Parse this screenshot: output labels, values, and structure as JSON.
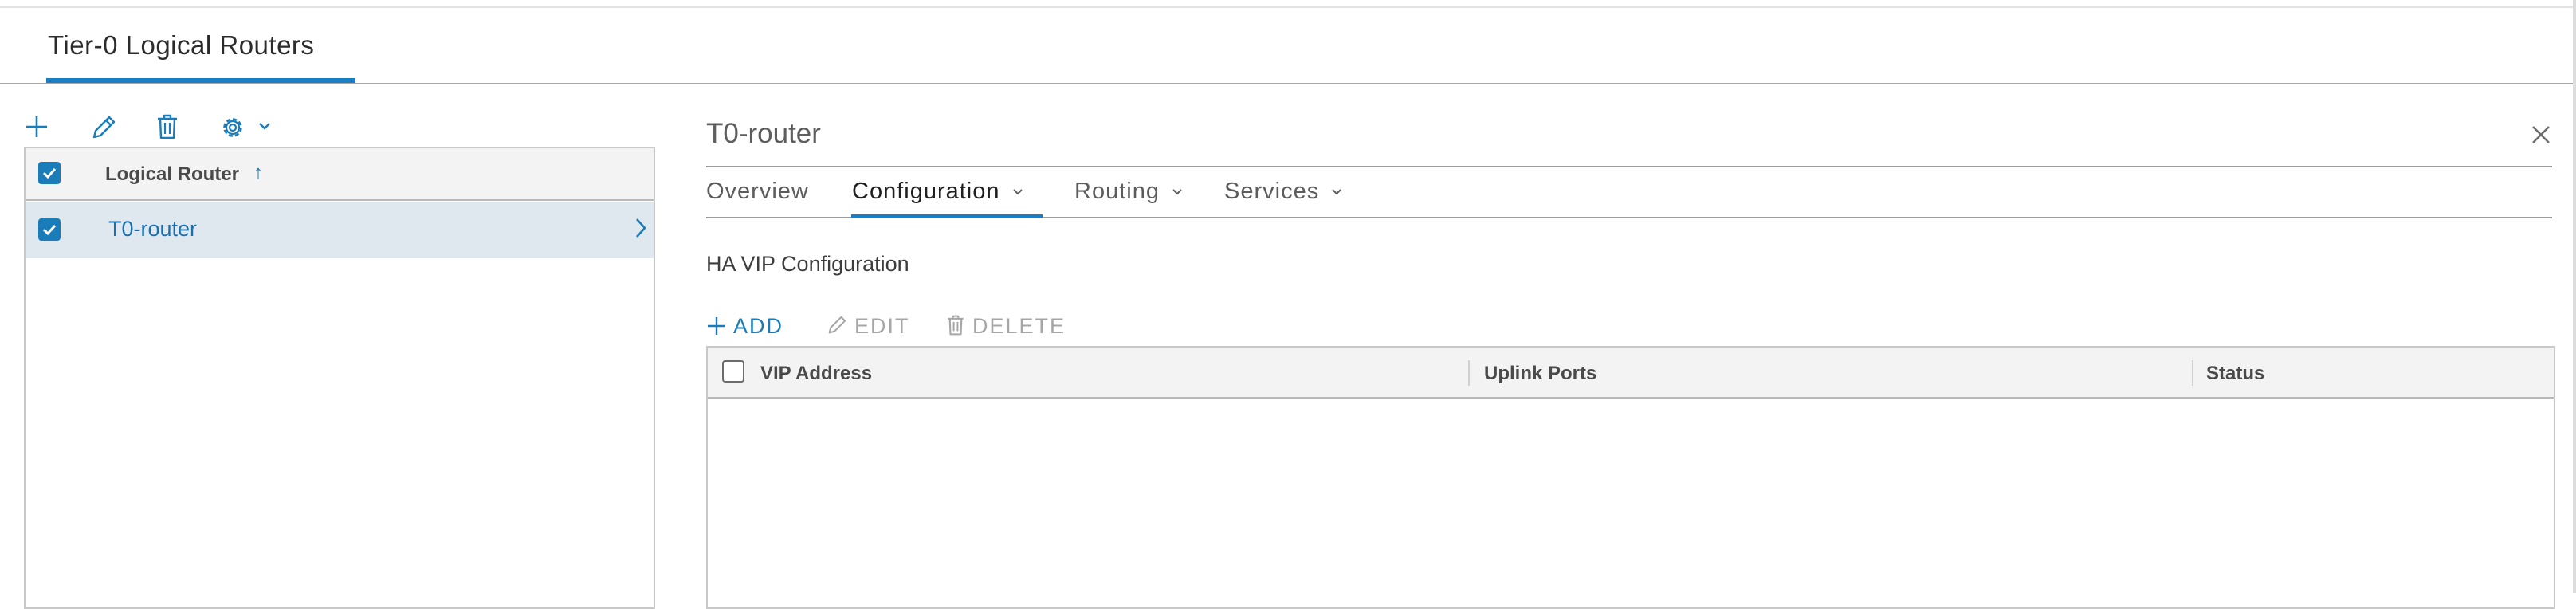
{
  "page": {
    "tab_title": "Tier-0 Logical Routers"
  },
  "left_toolbar": {
    "icons": [
      "plus-icon",
      "pencil-icon",
      "trash-icon",
      "gear-icon",
      "chevron-down-icon"
    ]
  },
  "left_grid": {
    "column_header": "Logical Router",
    "sort_indicator": "↑",
    "rows": [
      {
        "name": "T0-router",
        "selected": true
      }
    ]
  },
  "detail": {
    "title": "T0-router",
    "tabs": [
      {
        "label": "Overview",
        "has_menu": false,
        "active": false
      },
      {
        "label": "Configuration",
        "has_menu": true,
        "active": true
      },
      {
        "label": "Routing",
        "has_menu": true,
        "active": false
      },
      {
        "label": "Services",
        "has_menu": true,
        "active": false
      }
    ],
    "section_title": "HA VIP Configuration",
    "actions": {
      "add": "ADD",
      "edit": "EDIT",
      "delete": "DELETE"
    },
    "grid": {
      "columns": [
        "VIP Address",
        "Uplink Ports",
        "Status"
      ],
      "rows": []
    }
  },
  "colors": {
    "accent": "#1a7cb9",
    "selected_row": "#dfe8ef",
    "header_bg": "#f3f3f3",
    "disabled": "#a6a6a6"
  }
}
